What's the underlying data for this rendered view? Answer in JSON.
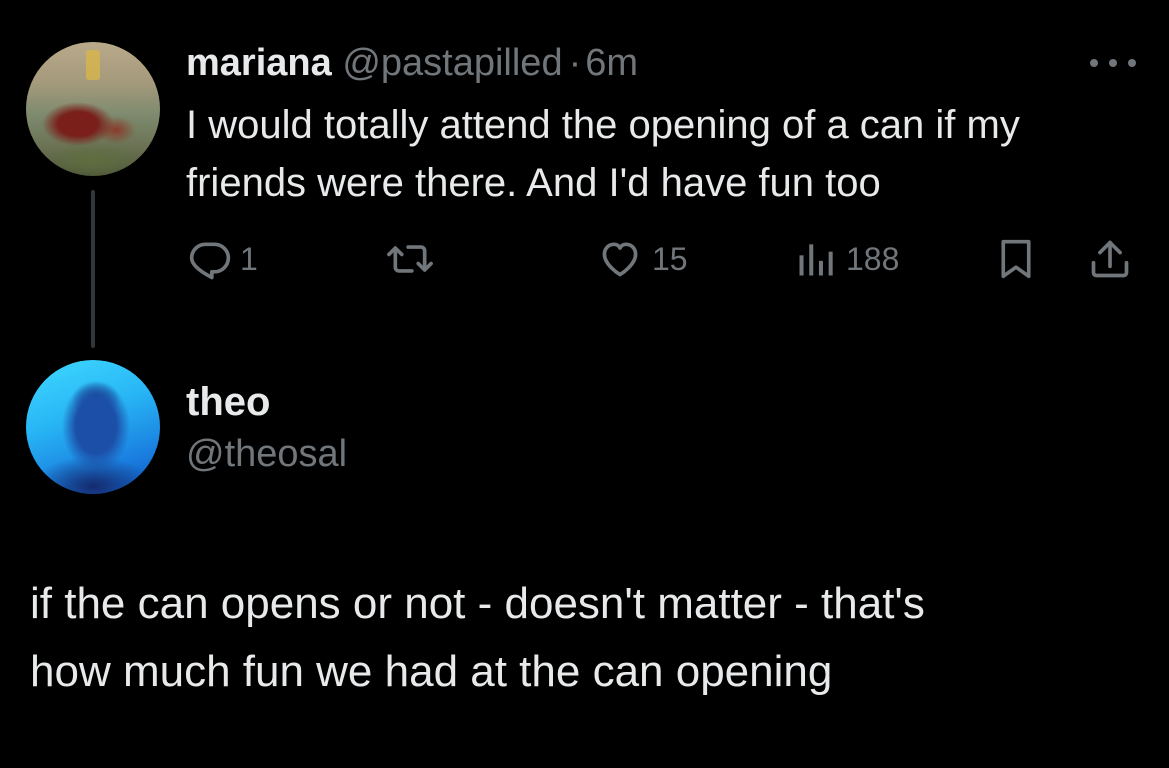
{
  "tweet": {
    "author": {
      "display_name": "mariana",
      "handle": "@pastapilled",
      "separator": "·",
      "time": "6m",
      "avatar": "profile-photo"
    },
    "text_line1": "I would totally attend the opening of a can if my",
    "text_line2": "friends were there. And I'd have fun too",
    "actions": {
      "reply_count": "1",
      "retweet_count": "",
      "like_count": "15",
      "view_count": "188"
    },
    "icons": {
      "more": "more-icon",
      "reply": "reply-icon",
      "retweet": "retweet-icon",
      "like": "heart-icon",
      "views": "views-icon",
      "bookmark": "bookmark-icon",
      "share": "share-icon"
    }
  },
  "reply": {
    "author": {
      "display_name": "theo",
      "handle": "@theosal",
      "avatar": "profile-photo"
    },
    "text_line1": "if the can opens or not - doesn't matter - that's",
    "text_line2": "how much fun we had at the can opening"
  },
  "colors": {
    "background": "#000000",
    "primary_text": "#e7e9ea",
    "secondary_text": "#71767b",
    "thread_line": "#333639"
  }
}
